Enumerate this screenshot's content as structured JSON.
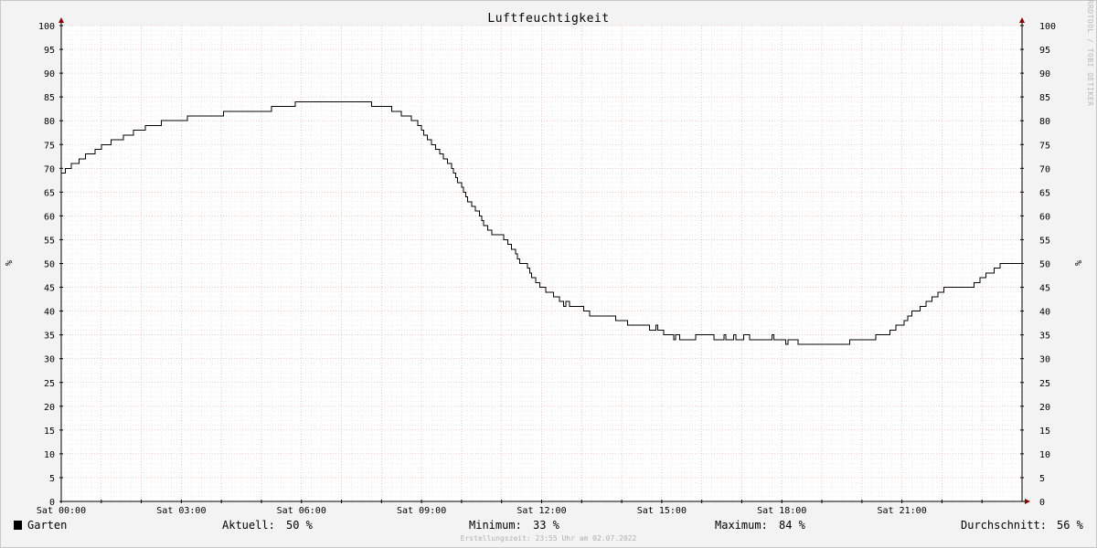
{
  "chart_data": {
    "type": "line",
    "title": "Luftfeuchtigkeit",
    "ylabel": "%",
    "ylim": [
      0,
      100
    ],
    "y_ticks": [
      "0",
      "5",
      "10",
      "15",
      "20",
      "25",
      "30",
      "35",
      "40",
      "45",
      "50",
      "55",
      "60",
      "65",
      "70",
      "75",
      "80",
      "85",
      "90",
      "95",
      "100"
    ],
    "xlim_hours": [
      0,
      24
    ],
    "x_ticks": [
      {
        "h": 0,
        "label": "Sat 00:00"
      },
      {
        "h": 3,
        "label": "Sat 03:00"
      },
      {
        "h": 6,
        "label": "Sat 06:00"
      },
      {
        "h": 9,
        "label": "Sat 09:00"
      },
      {
        "h": 12,
        "label": "Sat 12:00"
      },
      {
        "h": 15,
        "label": "Sat 15:00"
      },
      {
        "h": 18,
        "label": "Sat 18:00"
      },
      {
        "h": 21,
        "label": "Sat 21:00"
      }
    ],
    "grid": true,
    "series": [
      {
        "name": "Garten",
        "color": "#000000",
        "step": true,
        "points": [
          [
            0.0,
            69
          ],
          [
            0.1,
            70
          ],
          [
            0.25,
            71
          ],
          [
            0.45,
            72
          ],
          [
            0.6,
            73
          ],
          [
            0.85,
            74
          ],
          [
            1.0,
            75
          ],
          [
            1.25,
            76
          ],
          [
            1.55,
            77
          ],
          [
            1.8,
            78
          ],
          [
            2.1,
            79
          ],
          [
            2.5,
            80
          ],
          [
            3.15,
            81
          ],
          [
            4.05,
            82
          ],
          [
            5.25,
            83
          ],
          [
            5.85,
            84
          ],
          [
            7.75,
            83
          ],
          [
            8.25,
            82
          ],
          [
            8.5,
            81
          ],
          [
            8.75,
            80
          ],
          [
            8.9,
            79
          ],
          [
            9.0,
            78
          ],
          [
            9.05,
            77
          ],
          [
            9.15,
            76
          ],
          [
            9.25,
            75
          ],
          [
            9.35,
            74
          ],
          [
            9.45,
            73
          ],
          [
            9.55,
            72
          ],
          [
            9.65,
            71
          ],
          [
            9.75,
            70
          ],
          [
            9.8,
            69
          ],
          [
            9.85,
            68
          ],
          [
            9.9,
            67
          ],
          [
            10.0,
            66
          ],
          [
            10.05,
            65
          ],
          [
            10.1,
            64
          ],
          [
            10.15,
            63
          ],
          [
            10.25,
            62
          ],
          [
            10.35,
            61
          ],
          [
            10.45,
            60
          ],
          [
            10.5,
            59
          ],
          [
            10.55,
            58
          ],
          [
            10.65,
            57
          ],
          [
            10.75,
            56
          ],
          [
            11.05,
            55
          ],
          [
            11.15,
            54
          ],
          [
            11.25,
            53
          ],
          [
            11.35,
            52
          ],
          [
            11.4,
            51
          ],
          [
            11.45,
            50
          ],
          [
            11.65,
            49
          ],
          [
            11.7,
            48
          ],
          [
            11.75,
            47
          ],
          [
            11.85,
            46
          ],
          [
            11.95,
            45
          ],
          [
            12.1,
            44
          ],
          [
            12.3,
            43
          ],
          [
            12.45,
            42
          ],
          [
            12.55,
            41
          ],
          [
            12.6,
            42
          ],
          [
            12.7,
            41
          ],
          [
            13.05,
            40
          ],
          [
            13.2,
            39
          ],
          [
            13.85,
            38
          ],
          [
            14.15,
            37
          ],
          [
            14.7,
            36
          ],
          [
            14.85,
            37
          ],
          [
            14.9,
            36
          ],
          [
            15.05,
            35
          ],
          [
            15.3,
            34
          ],
          [
            15.35,
            35
          ],
          [
            15.45,
            34
          ],
          [
            15.85,
            35
          ],
          [
            16.3,
            34
          ],
          [
            16.55,
            35
          ],
          [
            16.6,
            34
          ],
          [
            16.8,
            35
          ],
          [
            16.85,
            34
          ],
          [
            17.05,
            35
          ],
          [
            17.2,
            34
          ],
          [
            17.75,
            35
          ],
          [
            17.8,
            34
          ],
          [
            18.0,
            34
          ],
          [
            18.1,
            33
          ],
          [
            18.15,
            34
          ],
          [
            18.4,
            33
          ],
          [
            19.7,
            34
          ],
          [
            20.35,
            35
          ],
          [
            20.7,
            36
          ],
          [
            20.85,
            37
          ],
          [
            21.05,
            38
          ],
          [
            21.15,
            39
          ],
          [
            21.25,
            40
          ],
          [
            21.45,
            41
          ],
          [
            21.6,
            42
          ],
          [
            21.75,
            43
          ],
          [
            21.9,
            44
          ],
          [
            22.05,
            45
          ],
          [
            22.8,
            46
          ],
          [
            22.95,
            47
          ],
          [
            23.1,
            48
          ],
          [
            23.3,
            49
          ],
          [
            23.45,
            50
          ],
          [
            24.0,
            50
          ]
        ]
      }
    ]
  },
  "watermark": "RRDTOOL / TOBI OETIKER",
  "legend": {
    "series_name": "Garten",
    "current_label": "Aktuell:",
    "current_value": "50 %",
    "min_label": "Minimum:",
    "min_value": "33 %",
    "max_label": "Maximum:",
    "max_value": "84 %",
    "avg_label": "Durchschnitt:",
    "avg_value": "56 %"
  },
  "footer": "Erstellungszeit: 23:55 Uhr am 02.07.2022"
}
